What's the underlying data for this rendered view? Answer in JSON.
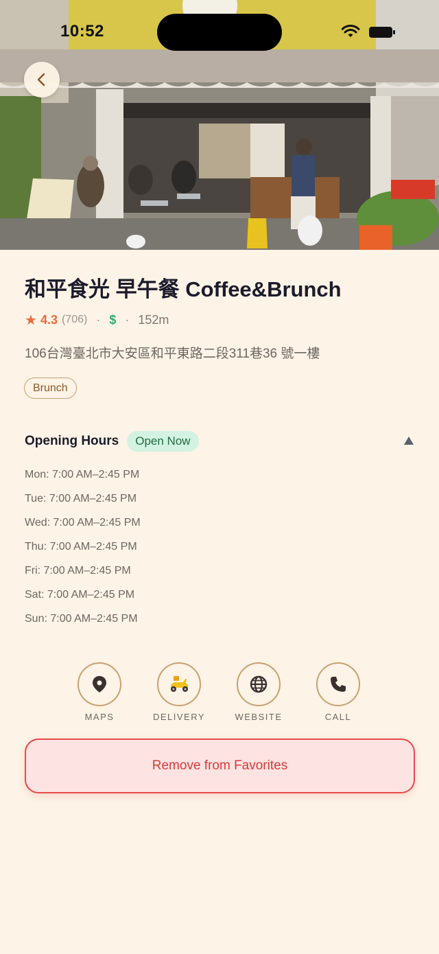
{
  "status_bar": {
    "time": "10:52"
  },
  "place": {
    "name": "和平食光 早午餐 Coffee&Brunch",
    "rating": "4.3",
    "review_count": "(706)",
    "price_level": "$",
    "distance": "152m",
    "address": "106台灣臺北市大安區和平東路二段311巷36 號一樓",
    "tag": "Brunch"
  },
  "hours": {
    "title": "Opening Hours",
    "status": "Open Now",
    "rows": [
      "Mon: 7:00 AM–2:45 PM",
      "Tue: 7:00 AM–2:45 PM",
      "Wed: 7:00 AM–2:45 PM",
      "Thu: 7:00 AM–2:45 PM",
      "Fri: 7:00 AM–2:45 PM",
      "Sat: 7:00 AM–2:45 PM",
      "Sun: 7:00 AM–2:45 PM"
    ]
  },
  "actions": [
    {
      "label": "MAPS",
      "icon": "map-pin-icon"
    },
    {
      "label": "DELIVERY",
      "icon": "scooter-icon"
    },
    {
      "label": "WEBSITE",
      "icon": "globe-icon"
    },
    {
      "label": "CALL",
      "icon": "phone-icon"
    }
  ],
  "favorite_button": {
    "label": "Remove from Favorites"
  },
  "colors": {
    "background": "#fdf3e6",
    "accent_border": "#c8a070",
    "rating": "#ea6b3d",
    "price": "#2fae6a",
    "open_badge_bg": "#d3f2e1",
    "danger": "#e84a4a"
  }
}
